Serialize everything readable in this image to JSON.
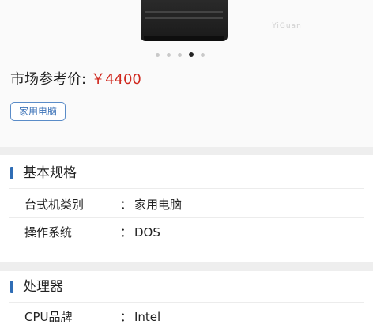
{
  "gallery": {
    "watermark": "YiGuan",
    "slide_count": 5,
    "active_index": 3
  },
  "price": {
    "label": "市场参考价:",
    "value": "￥4400",
    "color": "#d0281e"
  },
  "tag": "家用电脑",
  "sections": [
    {
      "title": "基本规格",
      "rows": [
        {
          "label": "台式机类别",
          "value": "家用电脑"
        },
        {
          "label": "操作系统",
          "value": "DOS"
        }
      ]
    },
    {
      "title": "处理器",
      "rows": [
        {
          "label": "CPU品牌",
          "value": "Intel"
        }
      ]
    }
  ],
  "separator": "：",
  "colors": {
    "accent": "#2f6db5",
    "tag_border": "#5a8cc8"
  }
}
